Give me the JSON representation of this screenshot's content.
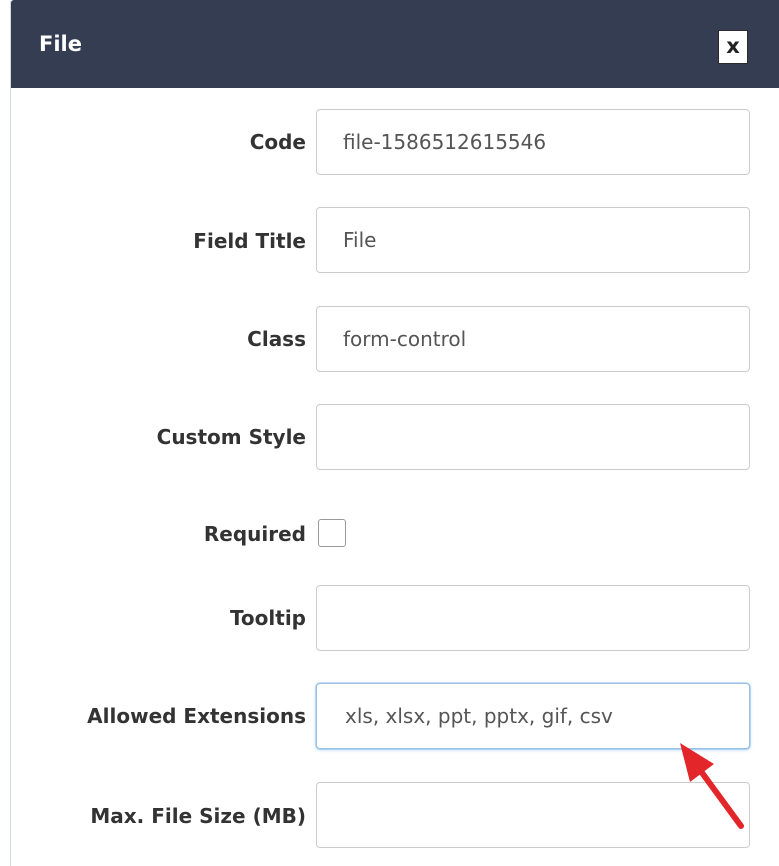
{
  "dialog": {
    "title": "File",
    "close_label": "x"
  },
  "fields": {
    "code": {
      "label": "Code",
      "value": "file-1586512615546"
    },
    "field_title": {
      "label": "Field Title",
      "value": "File"
    },
    "class": {
      "label": "Class",
      "value": "form-control"
    },
    "custom_style": {
      "label": "Custom Style",
      "value": ""
    },
    "required": {
      "label": "Required",
      "checked": false
    },
    "tooltip": {
      "label": "Tooltip",
      "value": ""
    },
    "allowed_extensions": {
      "label": "Allowed Extensions",
      "value": "xls, xlsx, ppt, pptx, gif, csv"
    },
    "max_file_size": {
      "label": "Max. File Size (MB)",
      "value": ""
    }
  },
  "annotation": {
    "arrow_color": "#e3262a",
    "points_to": "allowed-extensions-input"
  },
  "colors": {
    "header_bg": "#343d52",
    "header_text": "#ffffff",
    "label_text": "#333333",
    "input_border": "#cccccc",
    "focus_border": "#9dbfe3"
  }
}
